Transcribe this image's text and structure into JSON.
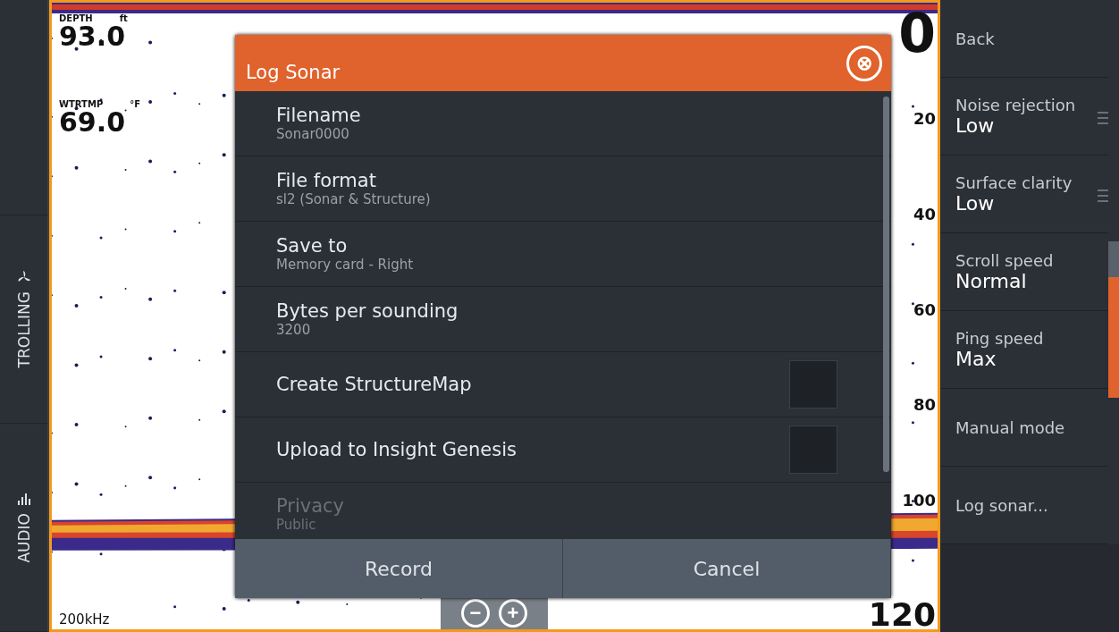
{
  "sidebar": {
    "items": [
      {
        "label": "TROLLING"
      },
      {
        "label": "AUDIO"
      }
    ]
  },
  "sonar": {
    "depth": {
      "label": "DEPTH",
      "unit": "ft",
      "value": "93.0"
    },
    "water_temp": {
      "label": "WTRTMP",
      "unit": "°F",
      "value": "69.0"
    },
    "frequency": "200kHz",
    "scale": [
      {
        "label": "0",
        "kind": "big"
      },
      {
        "label": "20",
        "kind": "small"
      },
      {
        "label": "40",
        "kind": "small"
      },
      {
        "label": "60",
        "kind": "small"
      },
      {
        "label": "80",
        "kind": "small"
      },
      {
        "label": "100",
        "kind": "small"
      },
      {
        "label": "120",
        "kind": "big"
      }
    ],
    "zoom_buttons": [
      "−",
      "+"
    ]
  },
  "dialog": {
    "title": "Log Sonar",
    "close": "⊗",
    "items": [
      {
        "kind": "value",
        "label": "Filename",
        "value": "Sonar0000",
        "disabled": false
      },
      {
        "kind": "value",
        "label": "File format",
        "value": "sl2 (Sonar & Structure)",
        "disabled": false
      },
      {
        "kind": "value",
        "label": "Save to",
        "value": "Memory card - Right",
        "disabled": false
      },
      {
        "kind": "value",
        "label": "Bytes per sounding",
        "value": "3200",
        "disabled": false
      },
      {
        "kind": "checkbox",
        "label": "Create StructureMap",
        "checked": false,
        "disabled": false
      },
      {
        "kind": "checkbox",
        "label": "Upload to Insight Genesis",
        "checked": false,
        "disabled": false
      },
      {
        "kind": "value",
        "label": "Privacy",
        "value": "Public",
        "disabled": true
      }
    ],
    "buttons": [
      "Record",
      "Cancel"
    ]
  },
  "menu": {
    "items": [
      {
        "kind": "plain",
        "label": "Back"
      },
      {
        "kind": "setting",
        "label": "Noise rejection",
        "value": "Low",
        "slider": true
      },
      {
        "kind": "setting",
        "label": "Surface clarity",
        "value": "Low",
        "slider": true
      },
      {
        "kind": "setting",
        "label": "Scroll speed",
        "value": "Normal"
      },
      {
        "kind": "setting",
        "label": "Ping speed",
        "value": "Max"
      },
      {
        "kind": "plain",
        "label": "Manual mode"
      },
      {
        "kind": "plain",
        "label": "Log sonar..."
      }
    ]
  }
}
